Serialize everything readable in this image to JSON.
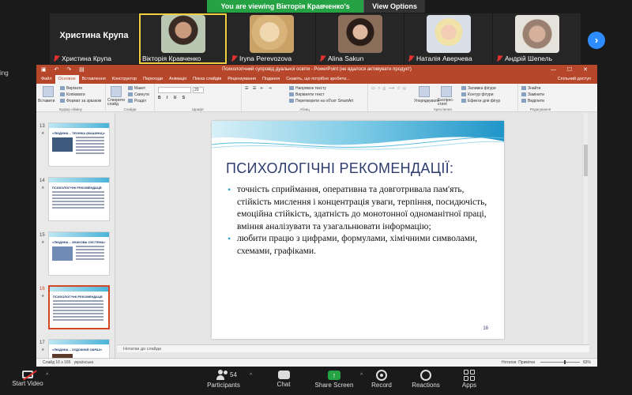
{
  "banner": {
    "text": "You are viewing Вікторія Кравченко's screen",
    "view_options": "View Options"
  },
  "side_label": "ing",
  "participants": [
    {
      "name": "Христина Крупа",
      "big_name": "Христина Крупа",
      "has_video": false
    },
    {
      "name": "Вікторія Кравченко",
      "has_video": true,
      "active": true
    },
    {
      "name": "Iryna Perevozova",
      "has_video": true
    },
    {
      "name": "Alina Sakun",
      "has_video": true
    },
    {
      "name": "Наталія Аверчева",
      "has_video": true
    },
    {
      "name": "Андрій Шепель",
      "has_video": true
    }
  ],
  "colors": {
    "accent_green": "#25a244",
    "zoom_blue": "#2d8cff",
    "ppt_red": "#b7472a",
    "slide_title": "#2e3c6e"
  },
  "ppt": {
    "title": "Психологічний супровід дуальної освіти - PowerPoint (не вдалося активувати продукт)",
    "tabs": [
      "Файл",
      "Основне",
      "Вставлення",
      "Конструктор",
      "Переходи",
      "Анімація",
      "Показ слайдів",
      "Рецензування",
      "Подання",
      "Скажіть, що потрібно зробити..."
    ],
    "share": "Спільний доступ",
    "ribbon": {
      "paste": "Вставити",
      "cut": "Вирізати",
      "copy": "Копіювати",
      "format_painter": "Формат за зразком",
      "clipboard": "Буфер обміну",
      "new_slide": "Створити слайд",
      "layout": "Макет",
      "reset": "Скинути",
      "section": "Розділ",
      "slides": "Слайди",
      "font_size": "20",
      "font": "Шрифт",
      "text_direction": "Напрямок тексту",
      "align_text": "Вирівняти текст",
      "smartart": "Перетворити на об'єкт SmartArt",
      "paragraph": "Абзац",
      "arrange": "Упорядкувати",
      "quick_styles": "Експрес-стилі",
      "shape_fill": "Заливка фігури",
      "shape_outline": "Контур фігури",
      "shape_effects": "Ефекти для фігур",
      "drawing": "Креслення",
      "find": "Знайти",
      "replace": "Замінити",
      "select": "Виділити",
      "editing": "Редагування"
    },
    "thumbnails": [
      {
        "num": "13",
        "title": "«ЛЮДИНА – ТЕХНІКА (МАШИНА)»",
        "has_img": true
      },
      {
        "num": "14",
        "title": "ПСИХОЛОГІЧНІ РЕКОМЕНДАЦІЇ:",
        "has_img": false
      },
      {
        "num": "15",
        "title": "«ЛЮДИНА – ЗНАКОВА СИСТЕМА»",
        "has_img": true
      },
      {
        "num": "16",
        "title": "ПСИХОЛОГІЧНІ РЕКОМЕНДАЦІЇ:",
        "has_img": false,
        "selected": true
      },
      {
        "num": "17",
        "title": "«ЛЮДИНА – ХУДОЖНІЙ ОБРАЗ»",
        "has_img": true
      }
    ],
    "slide": {
      "title": "ПСИХОЛОГІЧНІ РЕКОМЕНДАЦІЇ:",
      "bullets": [
        "точність сприймання, оперативна та довготривала пам'ять, стійкість мислення і концентрація уваги, терпіння, посидючість, емоційна стійкість, здатність до монотонної одноманітної праці, вміння аналізувати та узагальнювати інформацію;",
        "любити працю з цифрами, формулами, хімічними символами, схемами, графіками."
      ],
      "number": "16"
    },
    "notes_placeholder": "Нотатки до слайда",
    "status": {
      "slide_info": "Слайд 16 з 165",
      "language": "українська",
      "notes": "Нотатки",
      "comments": "Примітки",
      "zoom": "83%"
    }
  },
  "toolbar": {
    "start_video": "Start Video",
    "participants": "Participants",
    "participants_count": "54",
    "chat": "Chat",
    "share_screen": "Share Screen",
    "record": "Record",
    "reactions": "Reactions",
    "apps": "Apps"
  }
}
